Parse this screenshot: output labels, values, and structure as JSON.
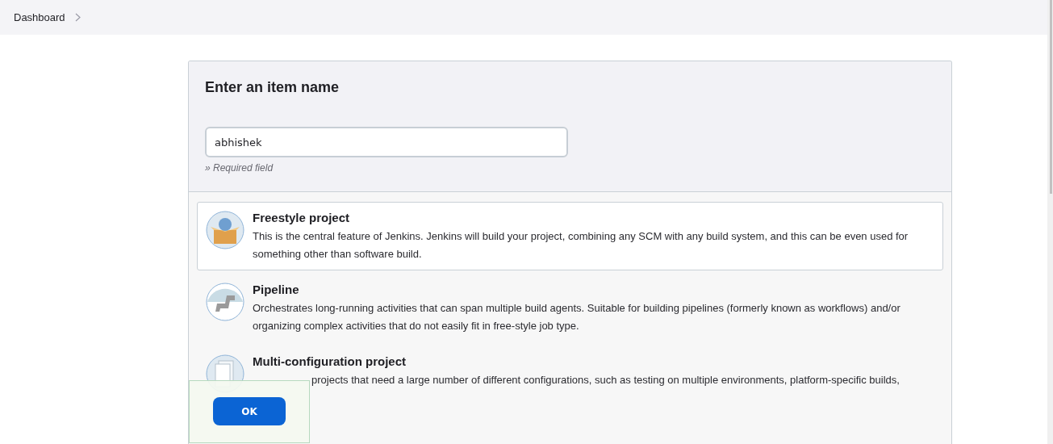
{
  "breadcrumb": [
    {
      "label": "Dashboard"
    }
  ],
  "form": {
    "title": "Enter an item name",
    "item_name": {
      "value": "abhishek"
    },
    "hint": "» Required field"
  },
  "item_types": [
    {
      "kind": "freestyle",
      "title": "Freestyle project",
      "description": "This is the central feature of Jenkins. Jenkins will build your project, combining any SCM with any build system, and this can be even used for something other than software build.",
      "selected": true
    },
    {
      "kind": "pipeline",
      "title": "Pipeline",
      "description": "Orchestrates long-running activities that can span multiple build agents. Suitable for building pipelines (formerly known as workflows) and/or organizing complex activities that do not easily fit in free-style job type.",
      "selected": false
    },
    {
      "kind": "matrix",
      "title": "Multi-configuration project",
      "description": "projects that need a large number of different configurations, such as testing on multiple environments, platform-specific builds,",
      "selected": false
    }
  ],
  "footer": {
    "ok_button": "OK"
  }
}
